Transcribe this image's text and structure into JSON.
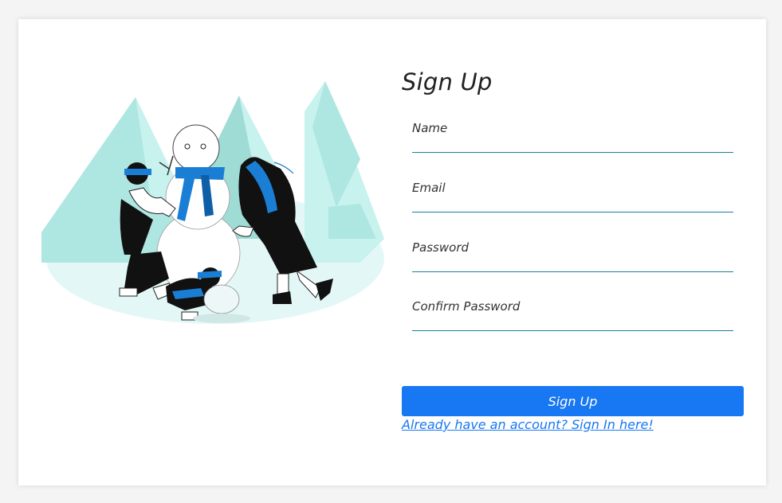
{
  "form": {
    "title": "Sign Up",
    "fields": [
      {
        "label": "Name",
        "value": "",
        "type": "text"
      },
      {
        "label": "Email",
        "value": "",
        "type": "email"
      },
      {
        "label": "Password",
        "value": "",
        "type": "password"
      },
      {
        "label": "Confirm Password",
        "value": "",
        "type": "password"
      }
    ],
    "submit_label": "Sign Up",
    "signin_link": "Already have an account? Sign In here!"
  },
  "colors": {
    "accent": "#1877f2",
    "field_underline": "#1a7f9c",
    "illustration_ground": "#e3f8f6",
    "mountains": "#aee6e1"
  },
  "illustration": {
    "icon": "snowman-family-illustration"
  }
}
